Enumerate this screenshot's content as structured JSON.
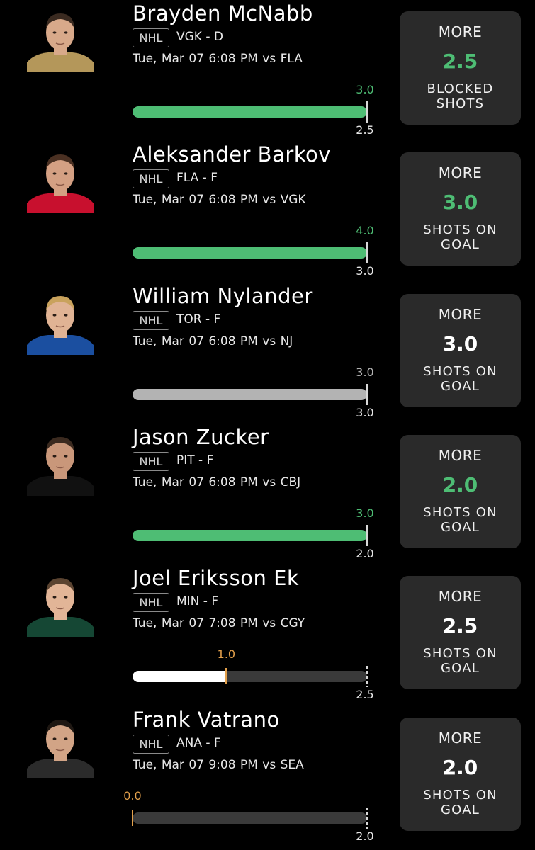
{
  "colors": {
    "background": "#000000",
    "card": "#2a2a2a",
    "hit_green": "#4ebd74",
    "push_gray": "#b3b3b3",
    "progress_white": "#ffffff",
    "progress_orange": "#e3a04b",
    "track": "#3a3a3a"
  },
  "picks": [
    {
      "name": "Brayden McNabb",
      "league": "NHL",
      "team_pos": "VGK - D",
      "game_time": "Tue, Mar 07 6:08 PM  vs FLA",
      "actual_label": "3.0",
      "target_label": "2.5",
      "progress": 1.0,
      "status": "hit",
      "direction": "MORE",
      "line": "2.5",
      "stat": "BLOCKED SHOTS",
      "stat_lines": [
        "BLOCKED",
        "SHOTS"
      ],
      "jersey_color": "#b4975a",
      "skin": "#d8a98a",
      "hair": "#3a2a20"
    },
    {
      "name": "Aleksander Barkov",
      "league": "NHL",
      "team_pos": "FLA - F",
      "game_time": "Tue, Mar 07 6:08 PM  vs VGK",
      "actual_label": "4.0",
      "target_label": "3.0",
      "progress": 1.0,
      "status": "hit",
      "direction": "MORE",
      "line": "3.0",
      "stat": "SHOTS ON GOAL",
      "stat_lines": [
        "SHOTS ON",
        "GOAL"
      ],
      "jersey_color": "#c8102e",
      "skin": "#d4a083",
      "hair": "#4a3022"
    },
    {
      "name": "William Nylander",
      "league": "NHL",
      "team_pos": "TOR - F",
      "game_time": "Tue, Mar 07 6:08 PM  vs NJ",
      "actual_label": "3.0",
      "target_label": "3.0",
      "progress": 1.0,
      "status": "push",
      "direction": "MORE",
      "line": "3.0",
      "stat": "SHOTS ON GOAL",
      "stat_lines": [
        "SHOTS ON",
        "GOAL"
      ],
      "jersey_color": "#1b4fa0",
      "skin": "#e0b394",
      "hair": "#c9a25c"
    },
    {
      "name": "Jason Zucker",
      "league": "NHL",
      "team_pos": "PIT - F",
      "game_time": "Tue, Mar 07 6:08 PM  vs CBJ",
      "actual_label": "3.0",
      "target_label": "2.0",
      "progress": 1.0,
      "status": "hit",
      "direction": "MORE",
      "line": "2.0",
      "stat": "SHOTS ON GOAL",
      "stat_lines": [
        "SHOTS ON",
        "GOAL"
      ],
      "jersey_color": "#111111",
      "skin": "#c9977a",
      "hair": "#3b2a1f"
    },
    {
      "name": "Joel Eriksson Ek",
      "league": "NHL",
      "team_pos": "MIN - F",
      "game_time": "Tue, Mar 07 7:08 PM  vs CGY",
      "actual_label": "1.0",
      "target_label": "2.5",
      "progress": 0.4,
      "status": "pending",
      "direction": "MORE",
      "line": "2.5",
      "stat": "SHOTS ON GOAL",
      "stat_lines": [
        "SHOTS ON",
        "GOAL"
      ],
      "jersey_color": "#154734",
      "skin": "#e2b597",
      "hair": "#5a4330"
    },
    {
      "name": "Frank Vatrano",
      "league": "NHL",
      "team_pos": "ANA - F",
      "game_time": "Tue, Mar 07 9:08 PM  vs SEA",
      "actual_label": "0.0",
      "target_label": "2.0",
      "progress": 0.0,
      "status": "pending",
      "direction": "MORE",
      "line": "2.0",
      "stat": "SHOTS ON GOAL",
      "stat_lines": [
        "SHOTS ON",
        "GOAL"
      ],
      "jersey_color": "#2b2b2b",
      "skin": "#d2a486",
      "hair": "#1e1712"
    }
  ]
}
